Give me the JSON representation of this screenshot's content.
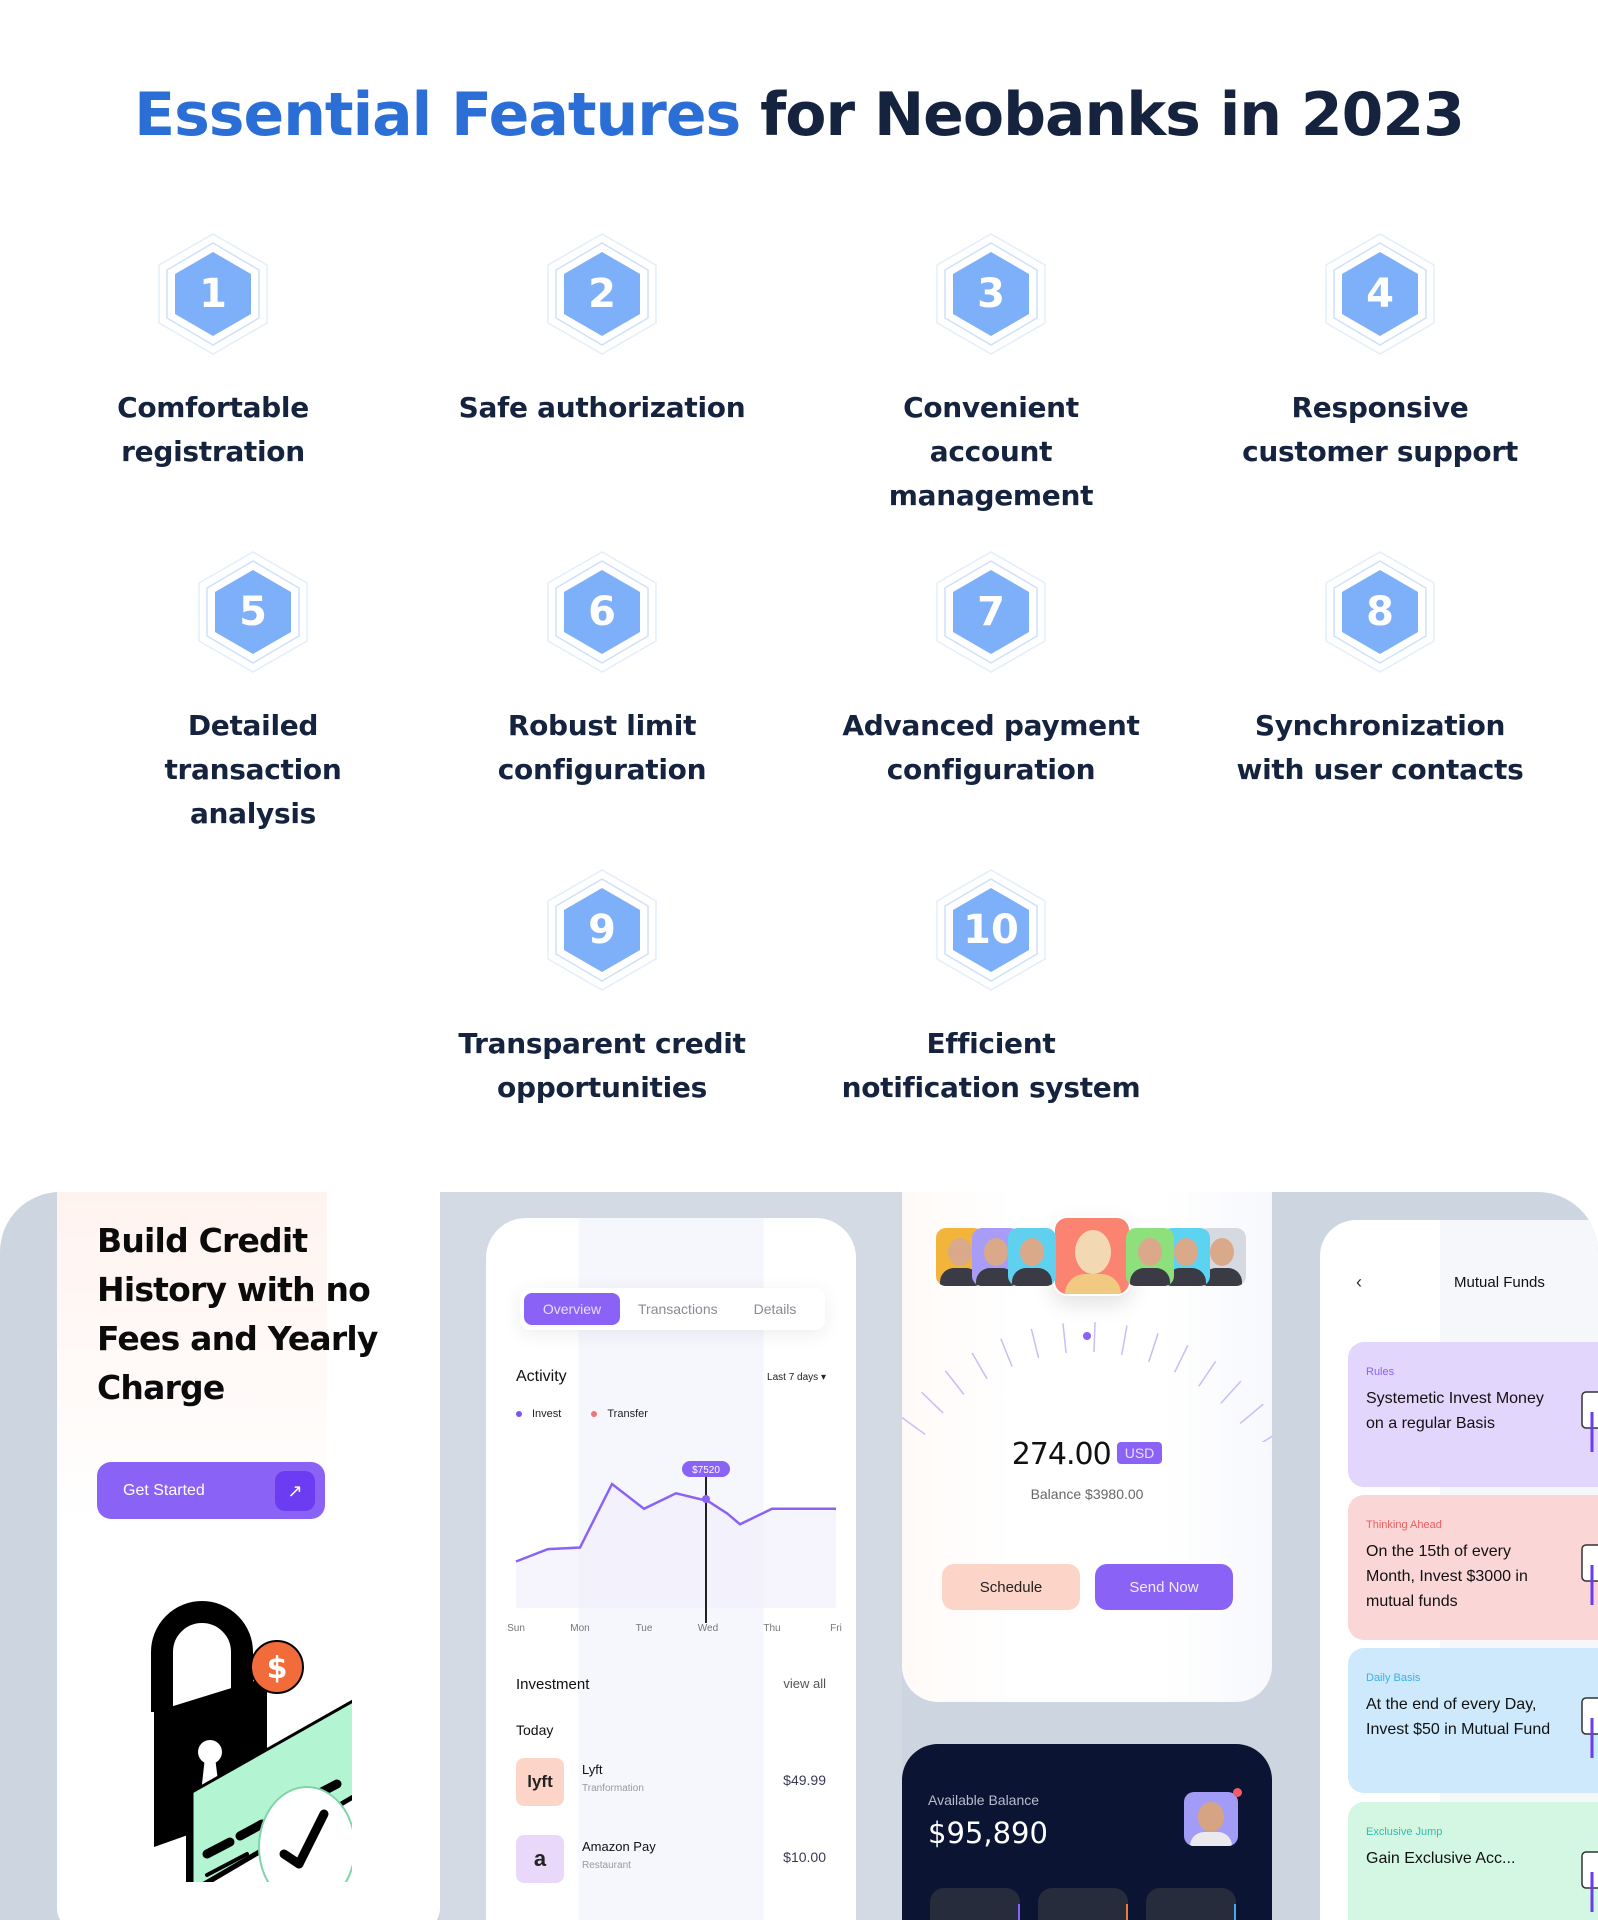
{
  "page": {
    "title_accent": "Essential Features",
    "title_rest": " for Neobanks in 2023",
    "accent_color": "#2b6fd6",
    "hex_color": "#7eaff9"
  },
  "features": [
    {
      "number": "1",
      "label": "Comfortable registration"
    },
    {
      "number": "2",
      "label": "Safe authorization"
    },
    {
      "number": "3",
      "label": "Convenient account management"
    },
    {
      "number": "4",
      "label": "Responsive customer support"
    },
    {
      "number": "5",
      "label": "Detailed transaction analysis"
    },
    {
      "number": "6",
      "label": "Robust limit configuration"
    },
    {
      "number": "7",
      "label": "Advanced payment configuration"
    },
    {
      "number": "8",
      "label": "Synchronization with user contacts"
    },
    {
      "number": "9",
      "label": "Transparent credit opportunities"
    },
    {
      "number": "10",
      "label": "Efficient notification system"
    }
  ],
  "credit_card": {
    "headline": "Build Credit History with no Fees and Yearly Charge",
    "button_label": "Get Started",
    "button_icon": "arrow-up-right-icon",
    "illustration": "lock-card-check-illustration"
  },
  "activity_screen": {
    "tabs": [
      {
        "label": "Overview",
        "active": true
      },
      {
        "label": "Transactions",
        "active": false
      },
      {
        "label": "Details",
        "active": false
      }
    ],
    "activity_title": "Activity",
    "range": "Last 7 days",
    "legend": [
      {
        "label": "Invest",
        "color": "#7b55f0"
      },
      {
        "label": "Transfer",
        "color": "#f0737a"
      }
    ],
    "tooltip": "$7520",
    "investment_title": "Investment",
    "view_all": "view all",
    "today": "Today",
    "transactions": [
      {
        "logo": "lyft",
        "name": "Lyft",
        "category": "Tranformation",
        "amount": "$49.99",
        "logo_bg": "#fcd5c8"
      },
      {
        "logo": "a",
        "name": "Amazon Pay",
        "category": "Restaurant",
        "amount": "$10.00",
        "logo_bg": "#ead8fb"
      }
    ]
  },
  "chart_data": {
    "type": "line",
    "title": "Activity",
    "categories": [
      "Sun",
      "Mon",
      "Tue",
      "Wed",
      "Thu",
      "Fri"
    ],
    "x": [
      0,
      0.5,
      1,
      1.5,
      2,
      2.5,
      3,
      3.3,
      3.5,
      4,
      4.5,
      5
    ],
    "series": [
      {
        "name": "Invest",
        "values": [
          3000,
          3800,
          3900,
          8000,
          6400,
          7400,
          6900,
          6100,
          5400,
          6400,
          6400,
          6400
        ]
      }
    ],
    "highlight": {
      "category": "Wed",
      "label": "$7520"
    },
    "ylim": [
      0,
      10000
    ],
    "grid": false,
    "legend": "top-left"
  },
  "transfer_screen": {
    "amount": "274.00",
    "currency": "USD",
    "balance": "Balance $3980.00",
    "schedule_label": "Schedule",
    "send_label": "Send Now",
    "avatar_colors": [
      "#f3b43c",
      "#a89cf7",
      "#5fd0ee",
      "#fb8372",
      "#8ee07c",
      "#5cd3f0",
      "#d6d9df"
    ]
  },
  "balance_screen": {
    "label": "Available Balance",
    "amount": "$95,890",
    "quick_action_colors": [
      "#8a63f6",
      "#f07a3b",
      "#48a8e8"
    ]
  },
  "mutual_funds": {
    "back_icon": "chevron-left-icon",
    "title": "Mutual Funds",
    "cards": [
      {
        "tag": "Rules",
        "text": "Systemetic Invest Money on a regular Basis",
        "bg": "#e2d6fd",
        "tag_color": "#8a63f6"
      },
      {
        "tag": "Thinking Ahead",
        "text": "On the 15th of every Month, Invest $3000 in mutual funds",
        "bg": "#fbd6d6",
        "tag_color": "#ea5f5f"
      },
      {
        "tag": "Daily Basis",
        "text": "At the end of every Day, Invest $50 in Mutual Fund",
        "bg": "#cde9fb",
        "tag_color": "#3bb1e8"
      },
      {
        "tag": "Exclusive Jump",
        "text": "Gain Exclusive Acc...",
        "bg": "#d4f7e4",
        "tag_color": "#2fbcae"
      }
    ]
  }
}
